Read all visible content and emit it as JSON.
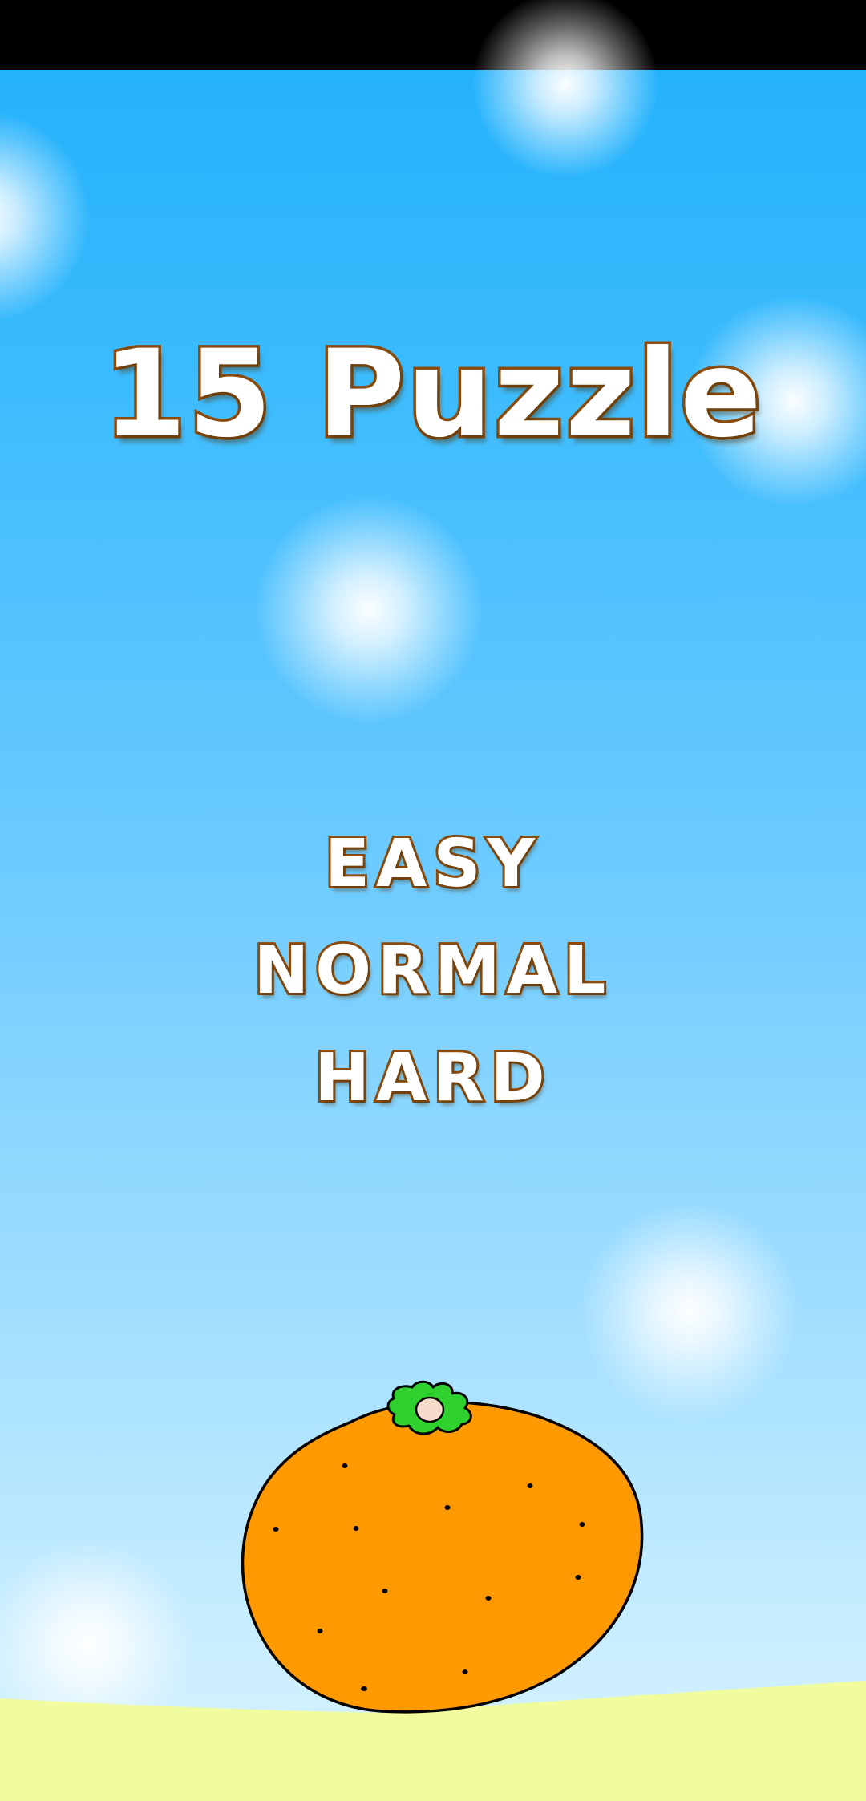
{
  "game": {
    "title": "15 Puzzle",
    "menu": {
      "easy": "EASY",
      "normal": "NORMAL",
      "hard": "HARD"
    },
    "mascot_icon": "mandarin-orange-icon"
  },
  "colors": {
    "sky_top": "#1fb0fb",
    "sky_bottom": "#d8f3ff",
    "text_outline": "#8a4b0c",
    "text_fill": "#ffffff",
    "orange": "#ff9900",
    "leaf": "#2ed12e",
    "ground": "#f0fc9e"
  }
}
